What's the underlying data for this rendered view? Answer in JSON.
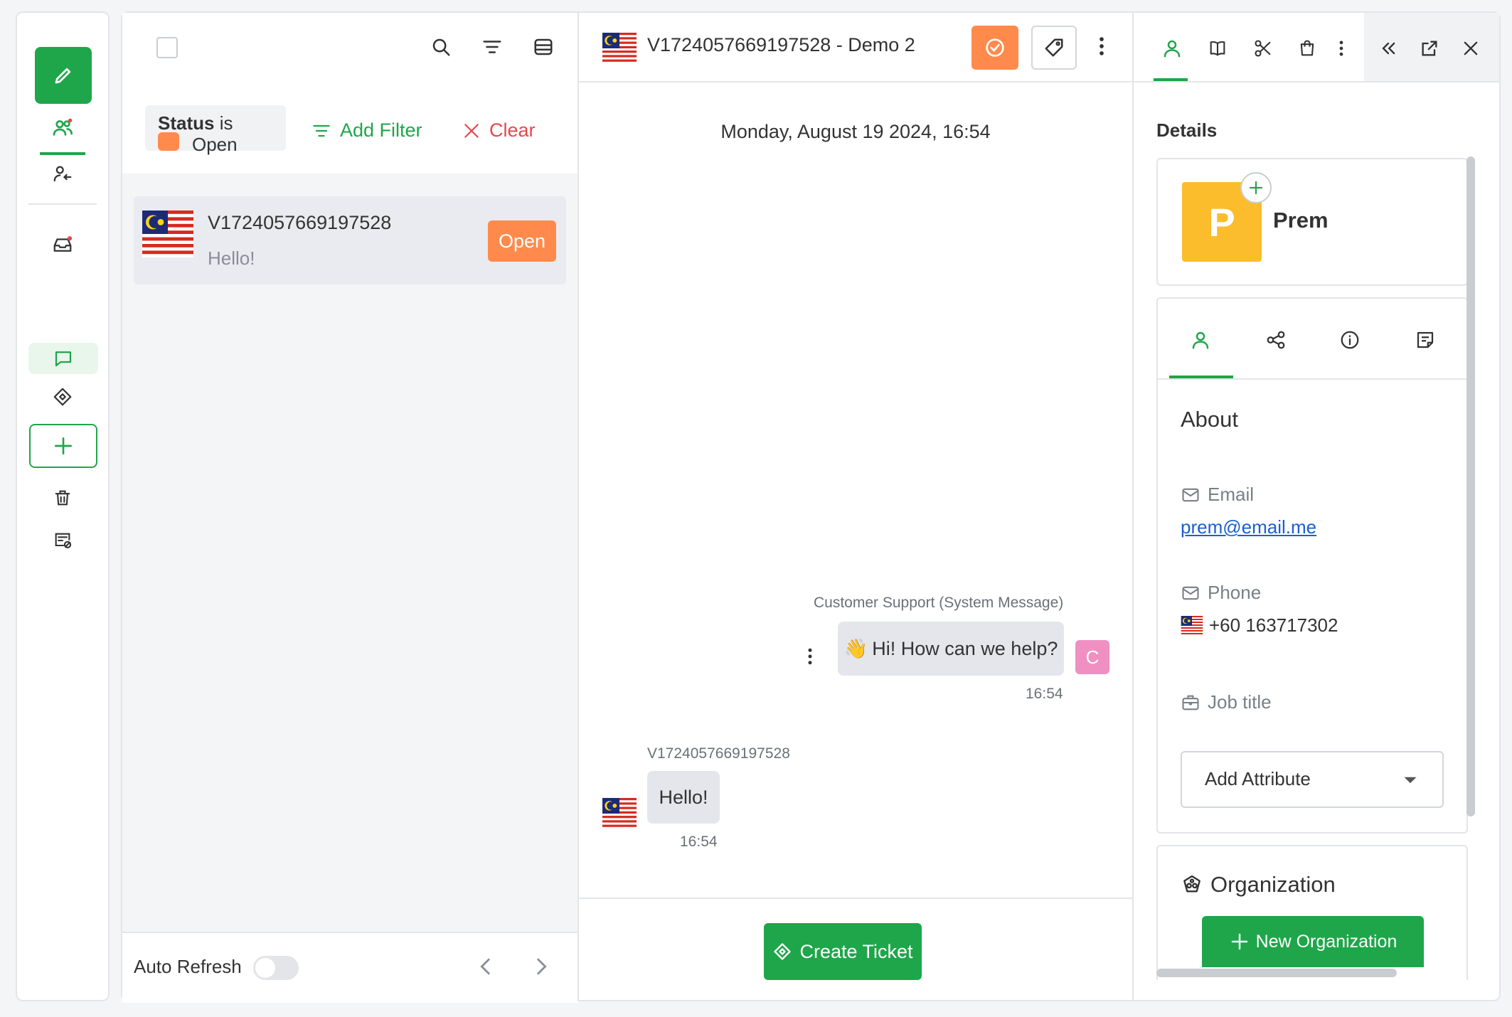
{
  "colors": {
    "brand": "#1fa64a",
    "open": "#ff8a4c",
    "danger": "#e5484d",
    "avatar_p": "#fbbd2c",
    "avatar_c": "#f08fc2"
  },
  "filters": {
    "chip_label": "Status",
    "chip_op": "is",
    "chip_value": "Open",
    "add_filter": "Add Filter",
    "clear": "Clear"
  },
  "conversations": [
    {
      "title": "V1724057669197528",
      "preview": "Hello!",
      "status": "Open"
    }
  ],
  "list_footer": {
    "auto_refresh": "Auto Refresh"
  },
  "chat": {
    "title": "V1724057669197528 - Demo 2",
    "date": "Monday, August 19 2024, 16:54",
    "messages": [
      {
        "sender": "Customer Support (System Message)",
        "text": "Hi! How can we help?",
        "emoji": "👋",
        "time": "16:54",
        "avatar": "C"
      },
      {
        "sender": "V1724057669197528",
        "text": "Hello!",
        "time": "16:54"
      }
    ],
    "create_ticket": "Create Ticket"
  },
  "details": {
    "heading": "Details",
    "contact_name": "Prem",
    "avatar_letter": "P",
    "about_heading": "About",
    "email_label": "Email",
    "email_value": "prem@email.me",
    "phone_label": "Phone",
    "phone_value": "+60 163717302",
    "job_label": "Job title",
    "add_attribute": "Add Attribute",
    "org_heading": "Organization",
    "new_org": "New Organization"
  }
}
